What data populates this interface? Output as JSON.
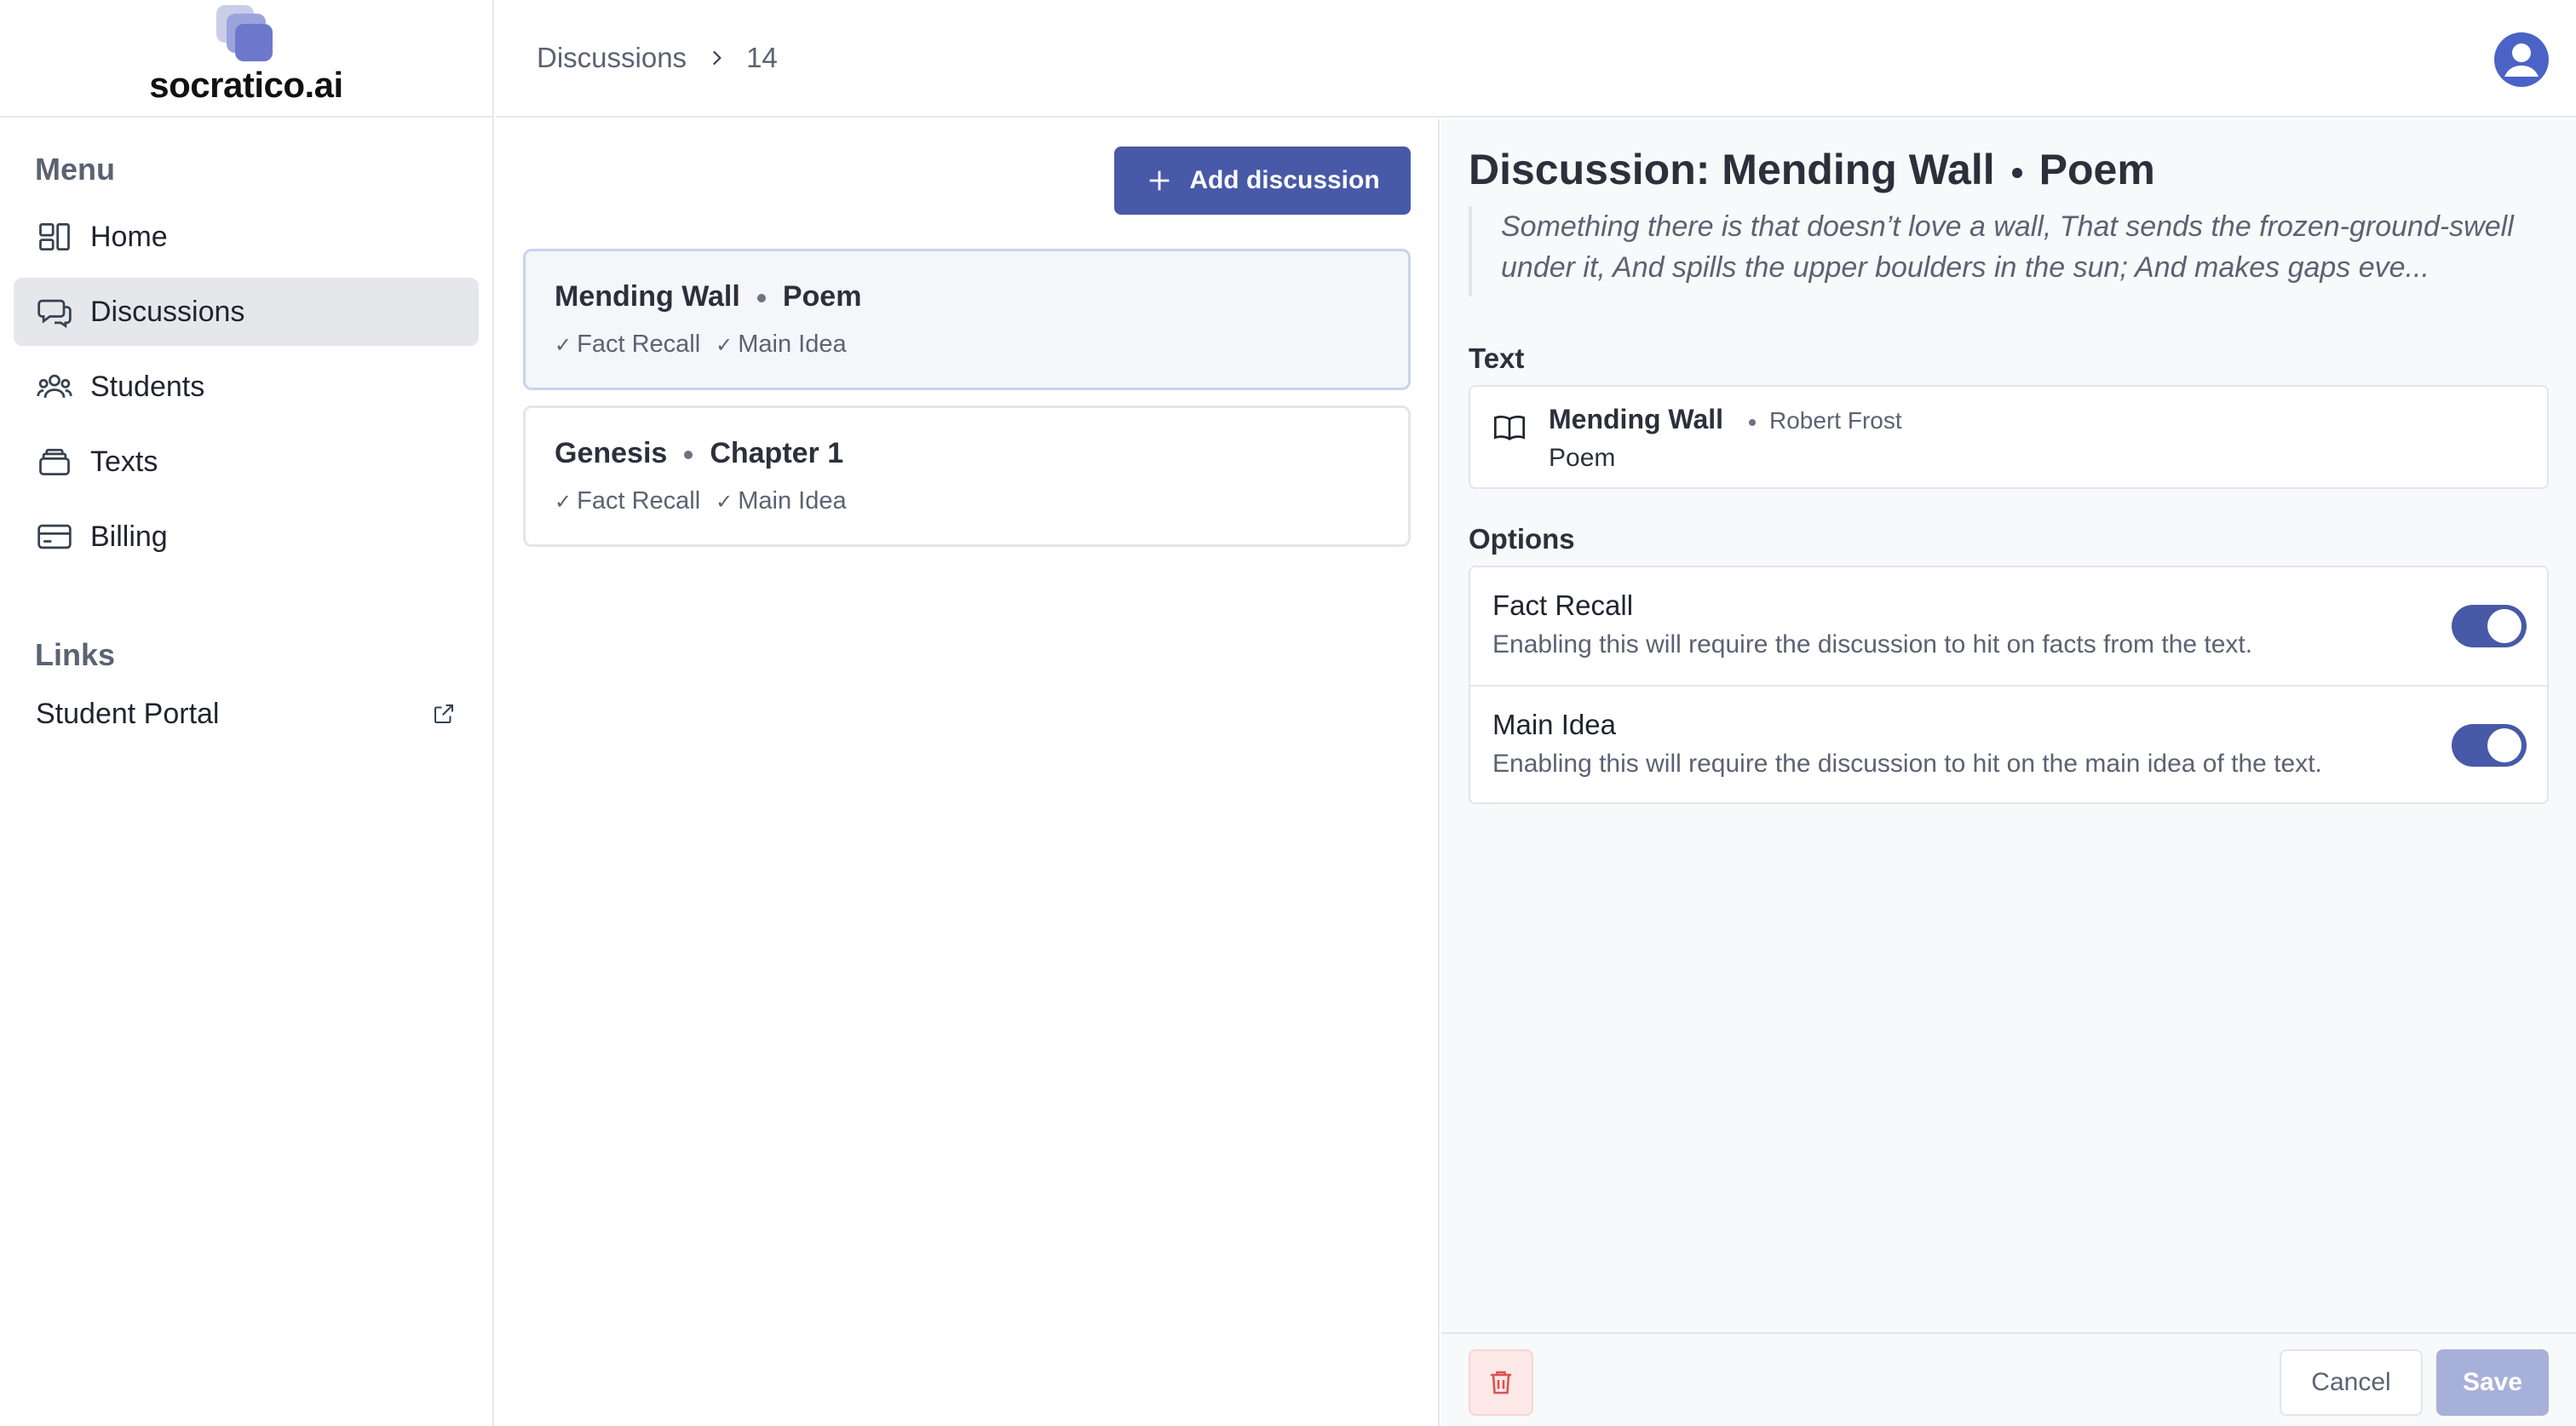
{
  "brand": {
    "name": "socratico.ai"
  },
  "sidebar": {
    "menu_title": "Menu",
    "items": [
      {
        "label": "Home",
        "icon": "home-icon"
      },
      {
        "label": "Discussions",
        "icon": "chat-icon",
        "active": true
      },
      {
        "label": "Students",
        "icon": "users-icon"
      },
      {
        "label": "Texts",
        "icon": "archive-icon"
      },
      {
        "label": "Billing",
        "icon": "credit-card-icon"
      }
    ],
    "links_title": "Links",
    "links": [
      {
        "label": "Student Portal",
        "icon": "external-link-icon"
      }
    ]
  },
  "breadcrumb": {
    "section": "Discussions",
    "count": "14"
  },
  "list": {
    "add_label": "Add discussion",
    "items": [
      {
        "title": "Mending Wall",
        "type": "Poem",
        "tags": [
          "Fact Recall",
          "Main Idea"
        ],
        "selected": true
      },
      {
        "title": "Genesis",
        "type": "Chapter 1",
        "tags": [
          "Fact Recall",
          "Main Idea"
        ]
      }
    ]
  },
  "detail": {
    "title_prefix": "Discussion: Mending Wall",
    "title_type": "Poem",
    "excerpt": "Something there is that doesn’t love a wall, That sends the frozen-ground-swell under it, And spills the upper boulders in the sun; And makes gaps eve...",
    "text_label": "Text",
    "text": {
      "title": "Mending Wall",
      "author": "Robert Frost",
      "type": "Poem"
    },
    "options_label": "Options",
    "options": [
      {
        "title": "Fact Recall",
        "desc": "Enabling this will require the discussion to hit on facts from the text.",
        "enabled": true
      },
      {
        "title": "Main Idea",
        "desc": "Enabling this will require the discussion to hit on the main idea of the text.",
        "enabled": true
      }
    ],
    "cancel_label": "Cancel",
    "save_label": "Save"
  },
  "colors": {
    "accent": "#4859a8",
    "save_disabled": "#a7b0d8",
    "danger": "#d9534f"
  }
}
